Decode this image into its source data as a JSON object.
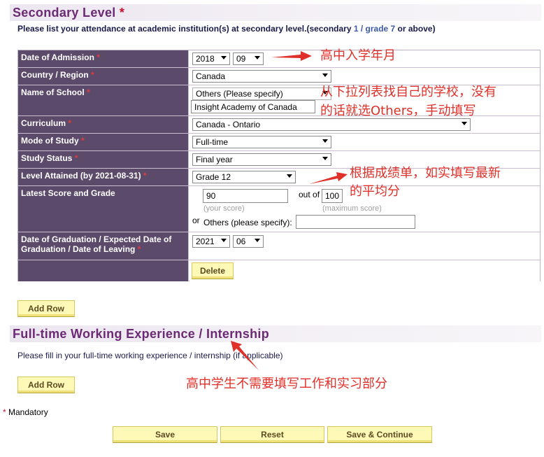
{
  "secondary": {
    "title": "Secondary Level",
    "star": "*",
    "intro_pre": "Please list your attendance at academic institution(s) at secondary level.(secondary ",
    "intro_em": "1 / grade 7",
    "intro_post": " or above)",
    "req_mark": "*",
    "rows": {
      "admission": {
        "label": "Date of Admission",
        "year": "2018",
        "month": "09"
      },
      "country": {
        "label": "Country / Region",
        "value": "Canada"
      },
      "school": {
        "label": "Name of School",
        "select": "Others (Please specify)",
        "other": "Insight Academy of Canada"
      },
      "curriculum": {
        "label": "Curriculum",
        "value": "Canada - Ontario"
      },
      "mode": {
        "label": "Mode of Study",
        "value": "Full-time"
      },
      "status": {
        "label": "Study Status",
        "value": "Final year"
      },
      "level": {
        "label": "Level Attained (by 2021-08-31)",
        "value": "Grade 12"
      },
      "score": {
        "label": "Latest Score and Grade",
        "score": "90",
        "out_of_label": "out of",
        "max": "100",
        "score_hint": "(your score)",
        "max_hint": "(maximum score)",
        "or_label": "or",
        "others_label": "Others (please specify):",
        "others_value": ""
      },
      "graduation": {
        "label": "Date of Graduation / Expected Date of Graduation / Date of Leaving",
        "year": "2021",
        "month": "06"
      }
    },
    "delete_label": "Delete",
    "add_row_label": "Add Row"
  },
  "work": {
    "title": "Full-time Working Experience / Internship",
    "intro": "Please fill in your full-time working experience / internship (if applicable)",
    "add_row_label": "Add Row"
  },
  "mandatory_note": {
    "star": "*",
    "text": " Mandatory"
  },
  "buttons": {
    "save": "Save",
    "reset": "Reset",
    "save_continue": "Save & Continue"
  },
  "annotations": {
    "admission": "高中入学年月",
    "school_1": "从下拉列表找自己的学校，没有",
    "school_2": "的话就选Others，手动填写",
    "score_1": "根据成绩单，如实填写最新",
    "score_2": "的平均分",
    "work": "高中学生不需要填写工作和实习部分"
  },
  "colors": {
    "label_bg": "#5c4a6b",
    "header_text": "#6b2a73",
    "annotation": "#e0302a",
    "button_bg": "#fff9b8"
  }
}
